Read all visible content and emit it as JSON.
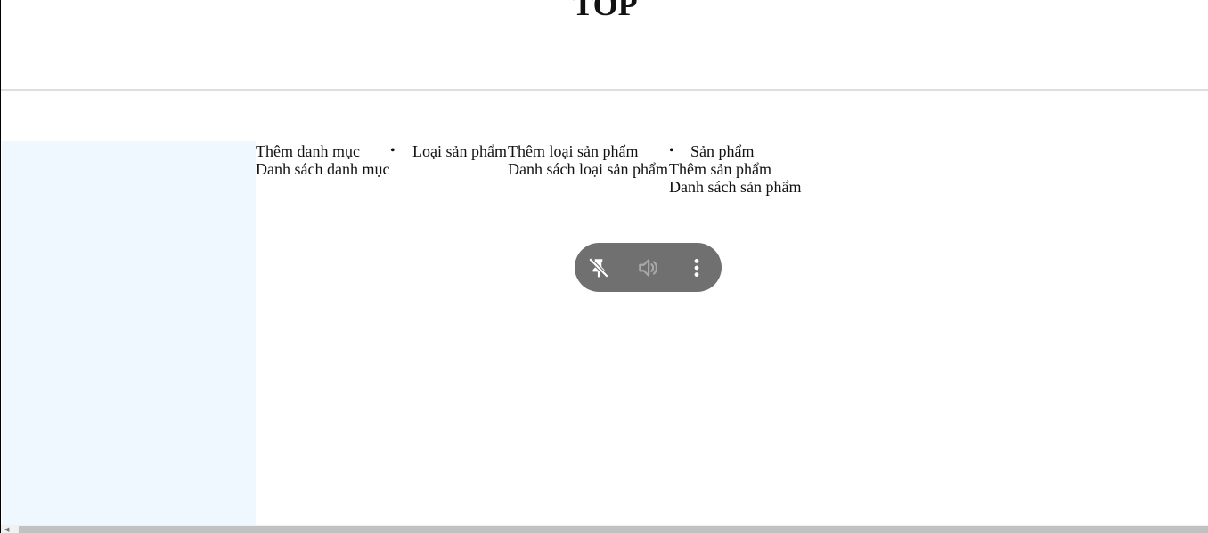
{
  "header": {
    "title": "TOP"
  },
  "menu": {
    "category": {
      "add": "Thêm danh mục",
      "list": "Danh sách danh mục"
    },
    "product_type": {
      "label": "Loại sản phẩm",
      "add": "Thêm loại sản phẩm",
      "list": "Danh sách loại sản phẩm"
    },
    "product": {
      "label": "Sản phẩm",
      "add": "Thêm sản phẩm",
      "list": "Danh sách sản phẩm"
    },
    "bullet": "•"
  },
  "media_bar": {
    "icons": [
      "unpin-icon",
      "speaker-icon",
      "more-vertical-icon"
    ]
  },
  "colors": {
    "sidebar_bg": "#f0f8ff",
    "bar_bg": "#707070",
    "divider": "#dedede"
  }
}
